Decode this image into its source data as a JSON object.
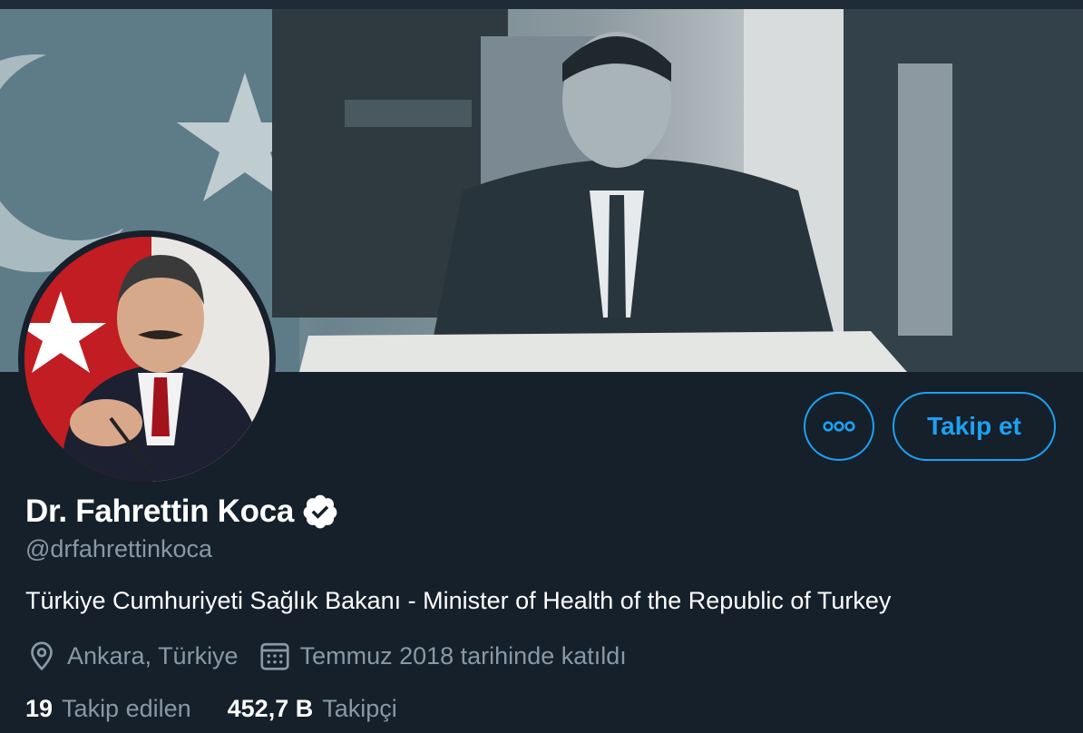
{
  "profile": {
    "name": "Dr. Fahrettin Koca",
    "handle": "@drfahrettinkoca",
    "bio": "Türkiye Cumhuriyeti Sağlık Bakanı - Minister of Health of the Republic of Turkey",
    "location": "Ankara, Türkiye",
    "joined": "Temmuz 2018 tarihinde katıldı",
    "verified": true
  },
  "actions": {
    "more_label": "ooo",
    "follow_label": "Takip et"
  },
  "stats": {
    "following_count": "19",
    "following_label": "Takip edilen",
    "followers_count": "452,7 B",
    "followers_label": "Takipçi"
  },
  "icons": {
    "location": "location-pin-icon",
    "calendar": "calendar-icon",
    "verified": "verified-badge-icon",
    "more": "more-options-icon"
  },
  "colors": {
    "background": "#15202b",
    "accent": "#1da1f2",
    "secondary_text": "#8899a6"
  }
}
